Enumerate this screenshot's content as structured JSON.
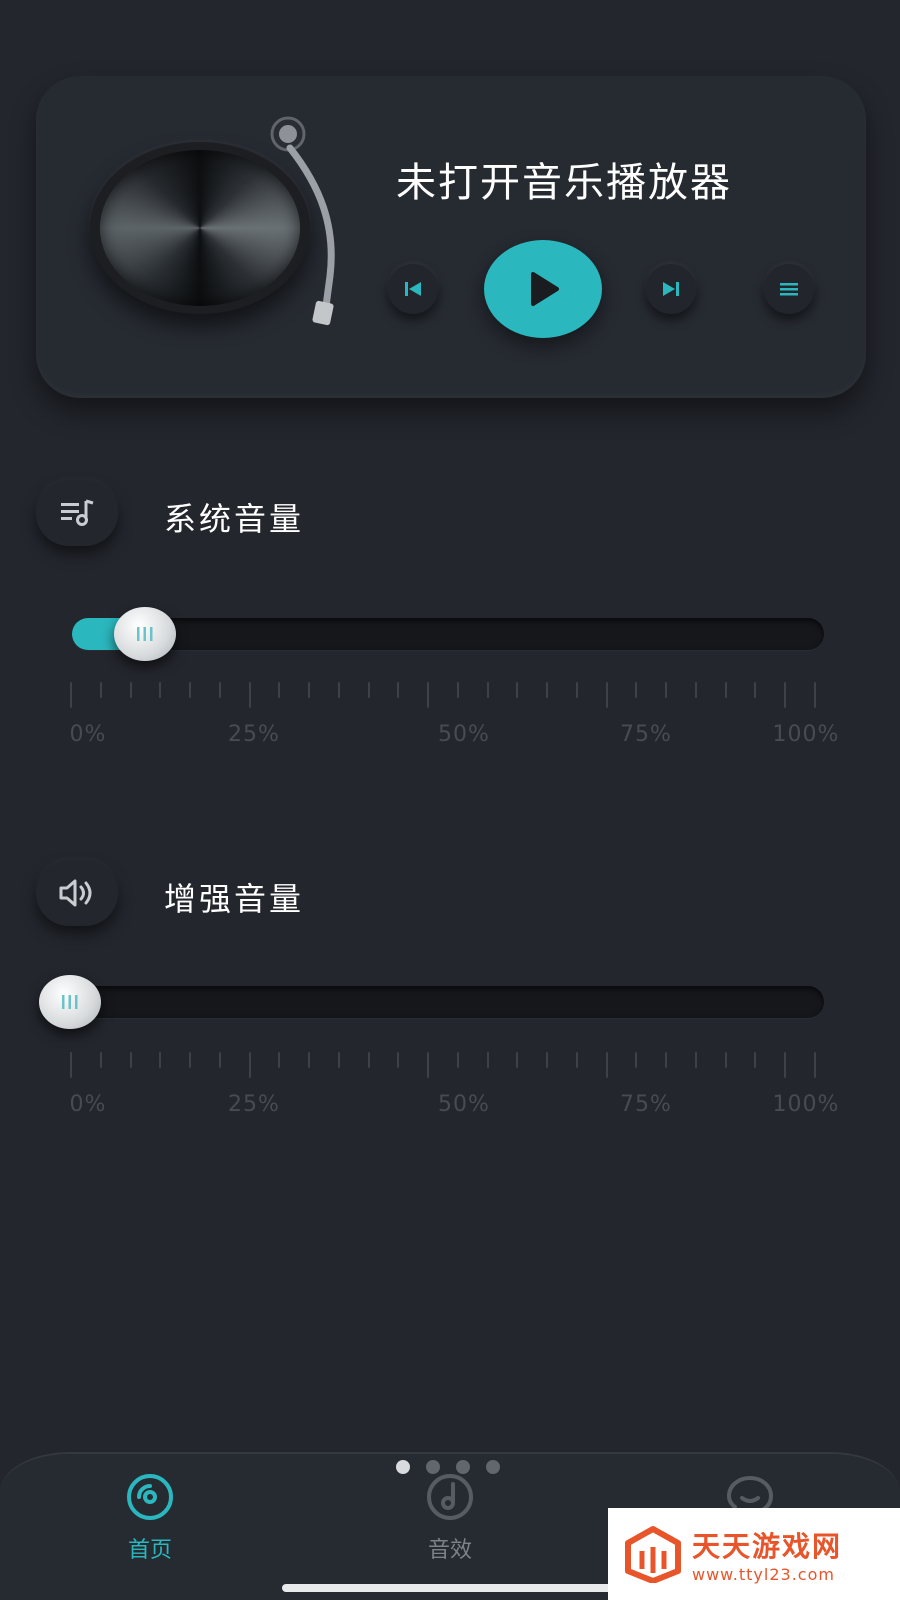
{
  "player": {
    "title": "未打开音乐播放器",
    "icons": {
      "prev": "skip-previous-icon",
      "play": "play-icon",
      "next": "skip-next-icon",
      "playlist": "menu-list-icon"
    }
  },
  "system_volume": {
    "label": "系统音量",
    "icon": "music-list-icon",
    "value_percent": 6
  },
  "boost_volume": {
    "label": "增强音量",
    "icon": "speaker-icon",
    "value_percent": 0
  },
  "scale": {
    "labels": [
      "0%",
      "25%",
      "50%",
      "75%",
      "100%"
    ]
  },
  "pager": {
    "count": 4,
    "active": 0
  },
  "nav": {
    "items": [
      {
        "label": "首页",
        "icon": "disc-icon"
      },
      {
        "label": "音效",
        "icon": "music-note-icon"
      },
      {
        "label": "",
        "icon": "chat-bubble-icon"
      }
    ]
  },
  "watermark": {
    "title": "天天游戏网",
    "url": "www.ttyl23.com"
  },
  "colors": {
    "accent": "#2ab7bd",
    "background": "#23262d",
    "card": "#262a31"
  }
}
